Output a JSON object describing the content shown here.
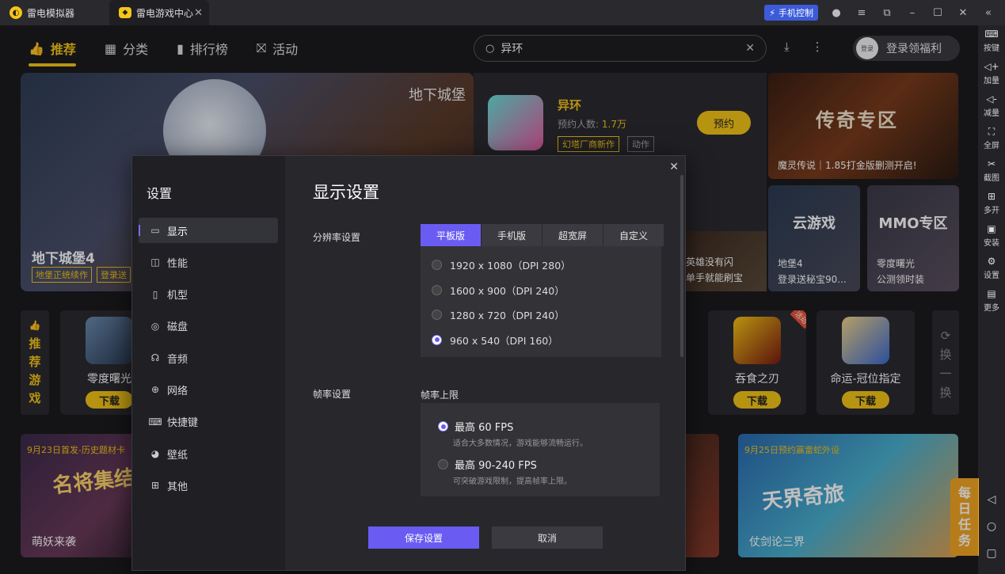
{
  "titlebar": {
    "tab1": "雷电模拟器",
    "tab2": "雷电游戏中心",
    "phone_control": "手机控制"
  },
  "right_toolbar": [
    {
      "label": "按键",
      "icon": "keyboard-icon"
    },
    {
      "label": "加量",
      "icon": "volume-up-icon"
    },
    {
      "label": "减量",
      "icon": "volume-down-icon"
    },
    {
      "label": "全屏",
      "icon": "fullscreen-icon"
    },
    {
      "label": "截图",
      "icon": "scissors-icon"
    },
    {
      "label": "多开",
      "icon": "multi-instance-icon"
    },
    {
      "label": "安装",
      "icon": "apk-icon"
    },
    {
      "label": "设置",
      "icon": "gear-icon"
    },
    {
      "label": "更多",
      "icon": "more-icon"
    }
  ],
  "nav": {
    "items": [
      "推荐",
      "分类",
      "排行榜",
      "活动"
    ],
    "search_value": "异环",
    "login_avatar": "登录",
    "login_label": "登录领福利"
  },
  "banner": {
    "title": "地下城堡4",
    "tag1": "地堡正统续作",
    "tag2": "登录送",
    "logo": "地下城堡"
  },
  "game_card": {
    "name": "异环",
    "reserve_label": "预约人数:",
    "reserve_count": "1.7万",
    "tag1": "幻塔厂商新作",
    "tag2": "动作",
    "button": "预约"
  },
  "legend_card": {
    "title": "传奇专区",
    "subtitle": "魔灵传说｜1.85打金版删测开启!"
  },
  "small_cards": [
    {
      "title": "云游戏",
      "line1": "地堡4",
      "line2": "登录送秘宝90..."
    },
    {
      "title": "MMO专区",
      "line1": "零度曙光",
      "line2": "公测领时装"
    }
  ],
  "partial_card": {
    "line1": "英雄没有闪",
    "line2": "单手就能刷宝"
  },
  "recommend": {
    "strip": [
      "推",
      "荐",
      "游",
      "戏"
    ],
    "games": [
      {
        "name": "零度曙光",
        "button": "下载"
      },
      {
        "name": "吞食之刃",
        "button": "下载",
        "ribbon": "活动"
      },
      {
        "name": "命运-冠位指定",
        "button": "下载"
      }
    ],
    "swap": [
      "换",
      "一",
      "换"
    ]
  },
  "bottom_cards": [
    {
      "tag": "9月23日首发-历史题材卡",
      "art": "名将集结",
      "title": "萌妖来袭"
    },
    {
      "tag": "9月25日预约赢雷蛇外设",
      "art": "天界奇旅",
      "title": "仗剑论三界"
    }
  ],
  "daily_task": [
    "每",
    "日",
    "任",
    "务"
  ],
  "settings": {
    "panel_title": "设置",
    "menu": [
      "显示",
      "性能",
      "机型",
      "磁盘",
      "音频",
      "网络",
      "快捷键",
      "壁纸",
      "其他"
    ],
    "active_menu": "显示",
    "title": "显示设置",
    "resolution_label": "分辨率设置",
    "res_tabs": [
      "平板版",
      "手机版",
      "超宽屏",
      "自定义"
    ],
    "resolutions": [
      "1920 x 1080（DPI 280）",
      "1600 x 900（DPI 240）",
      "1280 x 720（DPI 240）",
      "960 x 540（DPI 160）"
    ],
    "selected_resolution": "960 x 540（DPI 160）",
    "fps_label": "帧率设置",
    "fps_limit_label": "帧率上限",
    "fps_options": [
      {
        "label": "最高 60 FPS",
        "desc": "适合大多数情况，游戏能够流畅运行。"
      },
      {
        "label": "最高 90-240 FPS",
        "desc": "可突破游戏限制，提高帧率上限。"
      }
    ],
    "selected_fps": "最高 60 FPS",
    "save_button": "保存设置",
    "cancel_button": "取消"
  },
  "colors": {
    "accent_yellow": "#f5c518",
    "accent_purple": "#6a5cf2",
    "background": "#1b1b1f"
  }
}
